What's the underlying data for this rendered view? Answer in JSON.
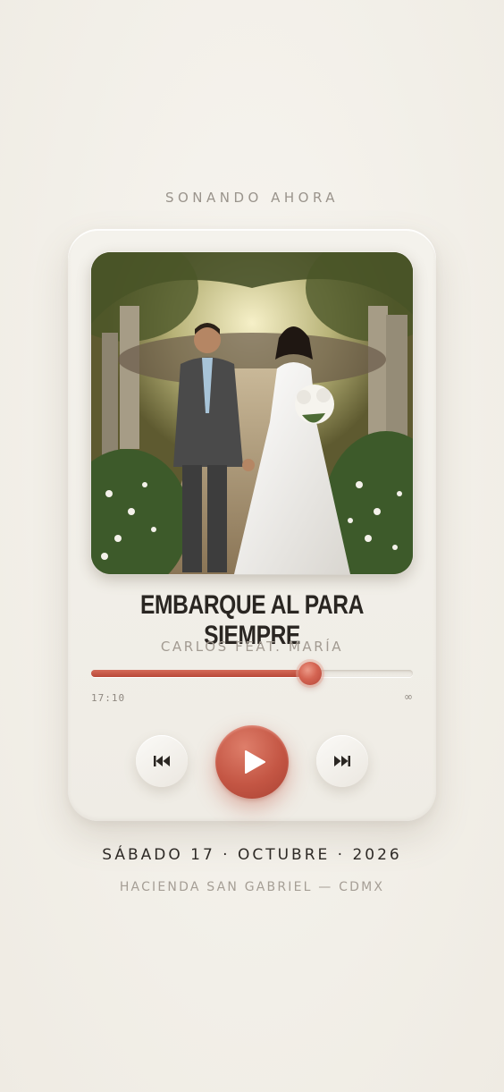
{
  "header": {
    "label": "SONANDO AHORA"
  },
  "player": {
    "song_title": "EMBARQUE AL PARA SIEMPRE",
    "artist": "CARLOS FEAT. MARÍA",
    "artwork_icon": "wedding-couple-photo",
    "progress": {
      "fraction": 0.68,
      "elapsed": "17:10",
      "total": "∞"
    },
    "controls": {
      "previous_icon": "skip-previous-icon",
      "play_icon": "play-icon",
      "next_icon": "skip-next-icon"
    },
    "colors": {
      "accent": "#c45644",
      "background": "#f3f0ea"
    }
  },
  "event": {
    "date": "SÁBADO 17 · OCTUBRE · 2026",
    "venue": "HACIENDA SAN GABRIEL — CDMX"
  }
}
